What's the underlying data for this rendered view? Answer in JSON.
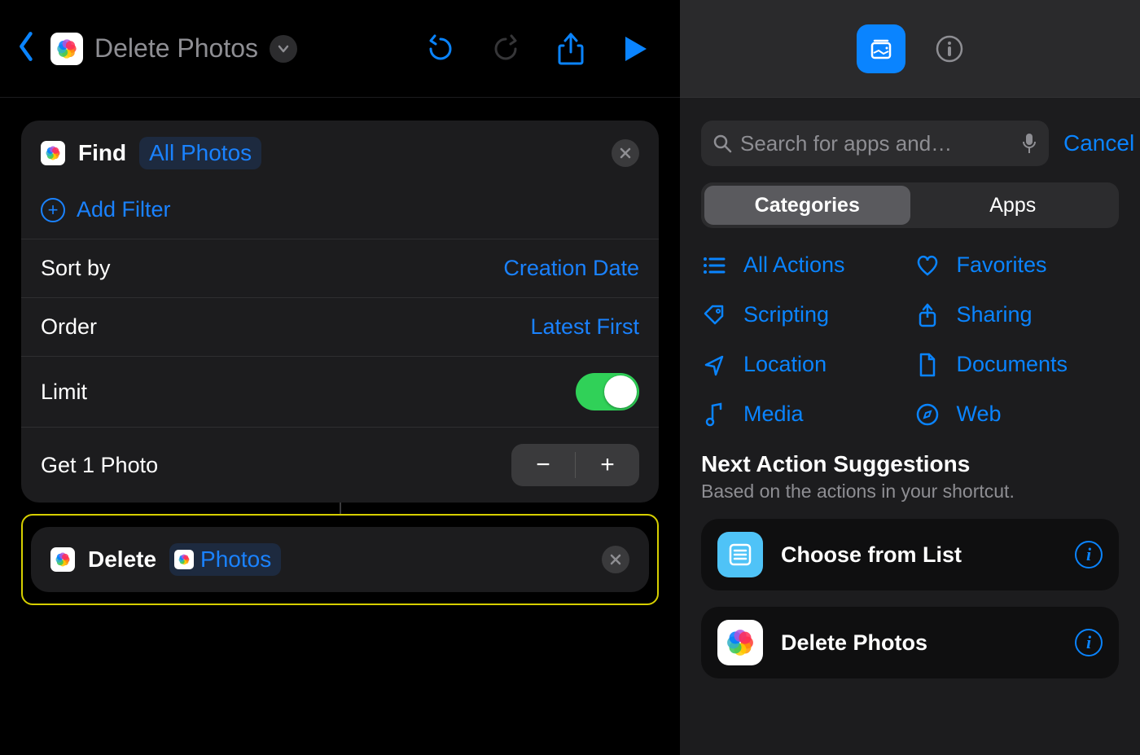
{
  "colors": {
    "accent": "#0a84ff",
    "link": "#1a82ff",
    "toggleOn": "#30d158"
  },
  "header": {
    "title": "Delete Photos"
  },
  "editor": {
    "find": {
      "verb": "Find",
      "param": "All Photos",
      "addFilter": "Add Filter",
      "rows": {
        "sortLabel": "Sort by",
        "sortValue": "Creation Date",
        "orderLabel": "Order",
        "orderValue": "Latest First",
        "limitLabel": "Limit",
        "limitOn": true,
        "getLabel": "Get 1 Photo"
      }
    },
    "delete": {
      "verb": "Delete",
      "param": "Photos"
    }
  },
  "library": {
    "search": {
      "placeholder": "Search for apps and…"
    },
    "cancel": "Cancel",
    "segments": {
      "categories": "Categories",
      "apps": "Apps",
      "selected": "categories"
    },
    "categories": [
      {
        "id": "all",
        "label": "All Actions"
      },
      {
        "id": "favorites",
        "label": "Favorites"
      },
      {
        "id": "scripting",
        "label": "Scripting"
      },
      {
        "id": "sharing",
        "label": "Sharing"
      },
      {
        "id": "location",
        "label": "Location"
      },
      {
        "id": "documents",
        "label": "Documents"
      },
      {
        "id": "media",
        "label": "Media"
      },
      {
        "id": "web",
        "label": "Web"
      }
    ],
    "suggestions": {
      "title": "Next Action Suggestions",
      "subtitle": "Based on the actions in your shortcut.",
      "items": [
        {
          "id": "choose-from-list",
          "label": "Choose from List"
        },
        {
          "id": "delete-photos",
          "label": "Delete Photos"
        }
      ]
    }
  }
}
